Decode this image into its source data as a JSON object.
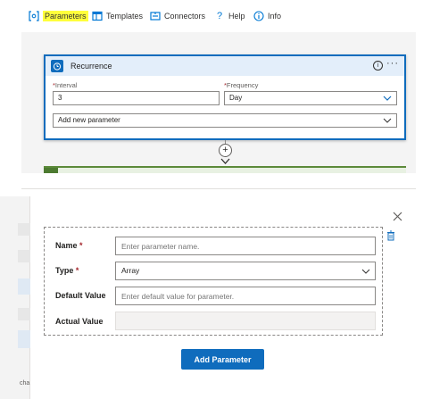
{
  "toolbar": {
    "parameters": "Parameters",
    "templates": "Templates",
    "connectors": "Connectors",
    "help": "Help",
    "info": "Info",
    "highlight_color": "#ffff3b",
    "icon_color": "#0078d4"
  },
  "trigger_card": {
    "title": "Recurrence",
    "icon": "clock-icon",
    "interval": {
      "label": "Interval",
      "required_mark": "*",
      "value": "3"
    },
    "frequency": {
      "label": "Frequency",
      "required_mark": "*",
      "value": "Day"
    },
    "add_parameter": "Add new parameter"
  },
  "param_form": {
    "name": {
      "label": "Name",
      "required_mark": "*",
      "placeholder": "Enter parameter name."
    },
    "type": {
      "label": "Type",
      "required_mark": "*",
      "value": "Array"
    },
    "default_value": {
      "label": "Default Value",
      "placeholder": "Enter default value for parameter."
    },
    "actual_value": {
      "label": "Actual Value",
      "value": ""
    },
    "add_button": "Add Parameter"
  },
  "colors": {
    "accent": "#0f6cbd",
    "required": "#a4262c",
    "card_header": "#e3eefa"
  },
  "side_panel": {
    "cut_text": "cha"
  }
}
